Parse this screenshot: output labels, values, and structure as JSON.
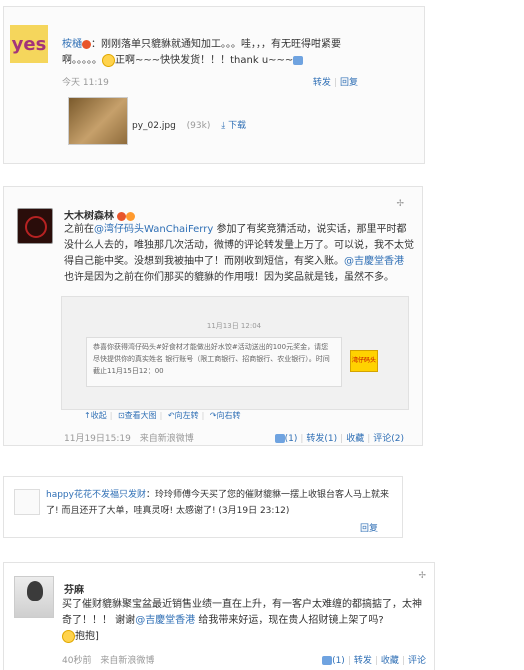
{
  "post1": {
    "avatar_text": "yes",
    "author": "桉樋",
    "text_a": "：刚刚落单只貔貅就通知加工。。。哇，，，有无旺得咁紧要啊。。。。。",
    "text_b": "正啊~~~快快发货！！！thank u~~~",
    "time": "今天 11:19",
    "forward": "转发",
    "reply": "回复",
    "file_name": "py_02.jpg",
    "file_size": "(93k)",
    "download": "下载"
  },
  "post2": {
    "author": "大木树森林",
    "fold": "✢",
    "text_pre": "之前在",
    "mention1": "@湾仔码头WanChaiFerry",
    "text_mid": " 参加了有奖竞猜活动，说实话，那里平时都没什么人去的，唯独那几次活动，微博的评论转发量上万了。可以说，我不太觉得自己能中奖。没想到我被抽中了！而刚收到短信，有奖入账。",
    "mention2": "@吉慶堂香港",
    "text_post": " 也许是因为之前在你们那买的貔貅的作用哦！因为奖品就是钱，虽然不多。",
    "quote_bar": [
      "收起",
      "查看大图",
      "向左转",
      "向右转"
    ],
    "quote_time": "11月13日 12:04",
    "quote_msg": "恭喜你获得湾仔码头#好食材才能做出好水饺#活动送出的100元奖金，请您尽快提供你的真实姓名 银行账号（限工商银行、招商银行、农业银行）。时间截止11月15日12：00",
    "quote_logo": "湾仔码头",
    "time": "11月19日15:19",
    "source": "来自新浪微博",
    "like": "(1)",
    "forward": "转发(1)",
    "collect": "收藏",
    "comment": "评论(2)"
  },
  "post3": {
    "author": "happy花花不发福只发财",
    "text": "：玲玲师傅今天买了您的催财貔貅一摆上收银台客人马上就来了! 而且还开了大单，哇真灵呀! 太感谢了! (3月19日 23:12)",
    "reply": "回复"
  },
  "post4": {
    "author": "芬麻",
    "fold": "✢",
    "text_a": "买了催财貔貅聚宝盆最近销售业绩一直在上升，有一客户太难缠的都搞掂了，太神奇了！！！ 谢谢",
    "mention": "@吉慶堂香港",
    "text_b": " 给我带来好运，现在贵人招财镜上架了吗?",
    "text_c": "抱抱]",
    "time": "40秒前",
    "source": "来自新浪微博",
    "like": "(1)",
    "forward": "转发",
    "collect": "收藏",
    "comment": "评论"
  }
}
